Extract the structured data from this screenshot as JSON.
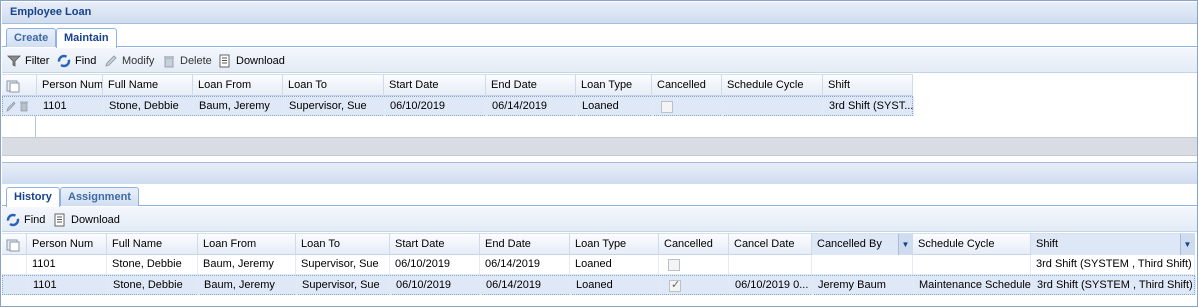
{
  "window": {
    "title": "Employee Loan"
  },
  "top_tabs": [
    {
      "label": "Create",
      "active": false
    },
    {
      "label": "Maintain",
      "active": true
    }
  ],
  "top_toolbar": {
    "filter": "Filter",
    "find": "Find",
    "modify": "Modify",
    "delete": "Delete",
    "download": "Download"
  },
  "top_grid": {
    "columns": [
      "Person Num",
      "Full Name",
      "Loan From",
      "Loan To",
      "Start Date",
      "End Date",
      "Loan Type",
      "Cancelled",
      "Schedule Cycle",
      "Shift"
    ],
    "sorted_column": "Person Num",
    "rows": [
      {
        "person_num": "1101",
        "full_name": "Stone, Debbie",
        "loan_from": "Baum, Jeremy",
        "loan_to": "Supervisor, Sue",
        "start_date": "06/10/2019",
        "end_date": "06/14/2019",
        "loan_type": "Loaned",
        "cancelled": false,
        "schedule_cycle": "",
        "shift": "3rd Shift (SYST..."
      }
    ]
  },
  "bottom_tabs": [
    {
      "label": "History",
      "active": true
    },
    {
      "label": "Assignment",
      "active": false
    }
  ],
  "bottom_toolbar": {
    "find": "Find",
    "download": "Download"
  },
  "bottom_grid": {
    "columns": [
      "Person Num",
      "Full Name",
      "Loan From",
      "Loan To",
      "Start Date",
      "End Date",
      "Loan Type",
      "Cancelled",
      "Cancel Date",
      "Cancelled By",
      "Schedule Cycle",
      "Shift"
    ],
    "rows": [
      {
        "person_num": "1101",
        "full_name": "Stone, Debbie",
        "loan_from": "Baum, Jeremy",
        "loan_to": "Supervisor, Sue",
        "start_date": "06/10/2019",
        "end_date": "06/14/2019",
        "loan_type": "Loaned",
        "cancelled": false,
        "cancel_date": "",
        "cancelled_by": "",
        "schedule_cycle": "",
        "shift": "3rd Shift (SYSTEM , Third Shift)"
      },
      {
        "person_num": "1101",
        "full_name": "Stone, Debbie",
        "loan_from": "Baum, Jeremy",
        "loan_to": "Supervisor, Sue",
        "start_date": "06/10/2019",
        "end_date": "06/14/2019",
        "loan_type": "Loaned",
        "cancelled": true,
        "cancel_date": "06/10/2019 0...",
        "cancelled_by": "Jeremy Baum",
        "schedule_cycle": "Maintenance Schedule",
        "shift": "3rd Shift (SYSTEM , Third Shift)"
      }
    ]
  },
  "colors": {
    "title_text": "#15428b",
    "selected_row": "#dfe8f6",
    "border": "#8aa4c8"
  }
}
